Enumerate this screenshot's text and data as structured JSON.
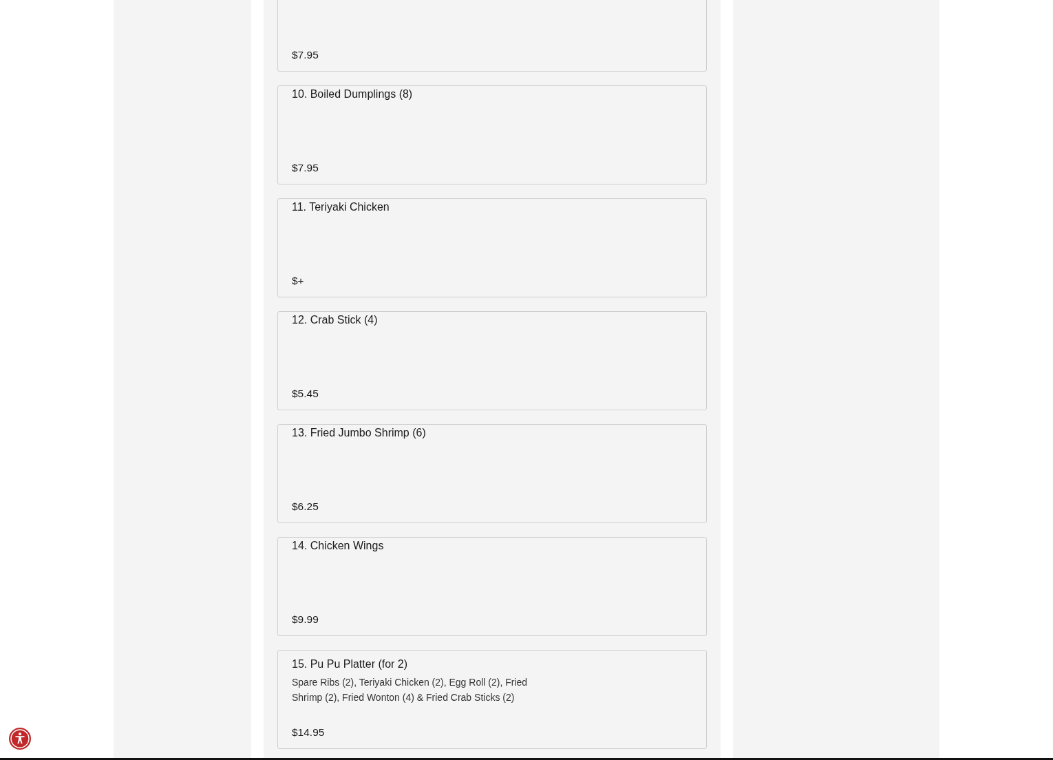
{
  "menu_items": [
    {
      "price": "$7.95"
    },
    {
      "title": "10. Boiled Dumplings (8)",
      "price": "$7.95"
    },
    {
      "title": "11. Teriyaki Chicken",
      "price": "$+"
    },
    {
      "title": "12. Crab Stick (4)",
      "price": "$5.45"
    },
    {
      "title": "13. Fried Jumbo Shrimp (6)",
      "price": "$6.25"
    },
    {
      "title": "14. Chicken Wings",
      "price": "$9.99"
    },
    {
      "title": "15. Pu Pu Platter (for 2)",
      "description": "Spare Ribs (2), Teriyaki Chicken (2), Egg Roll (2), Fried Shrimp (2), Fried Wonton (4) & Fried Crab Sticks (2)",
      "price": "$14.95"
    }
  ]
}
